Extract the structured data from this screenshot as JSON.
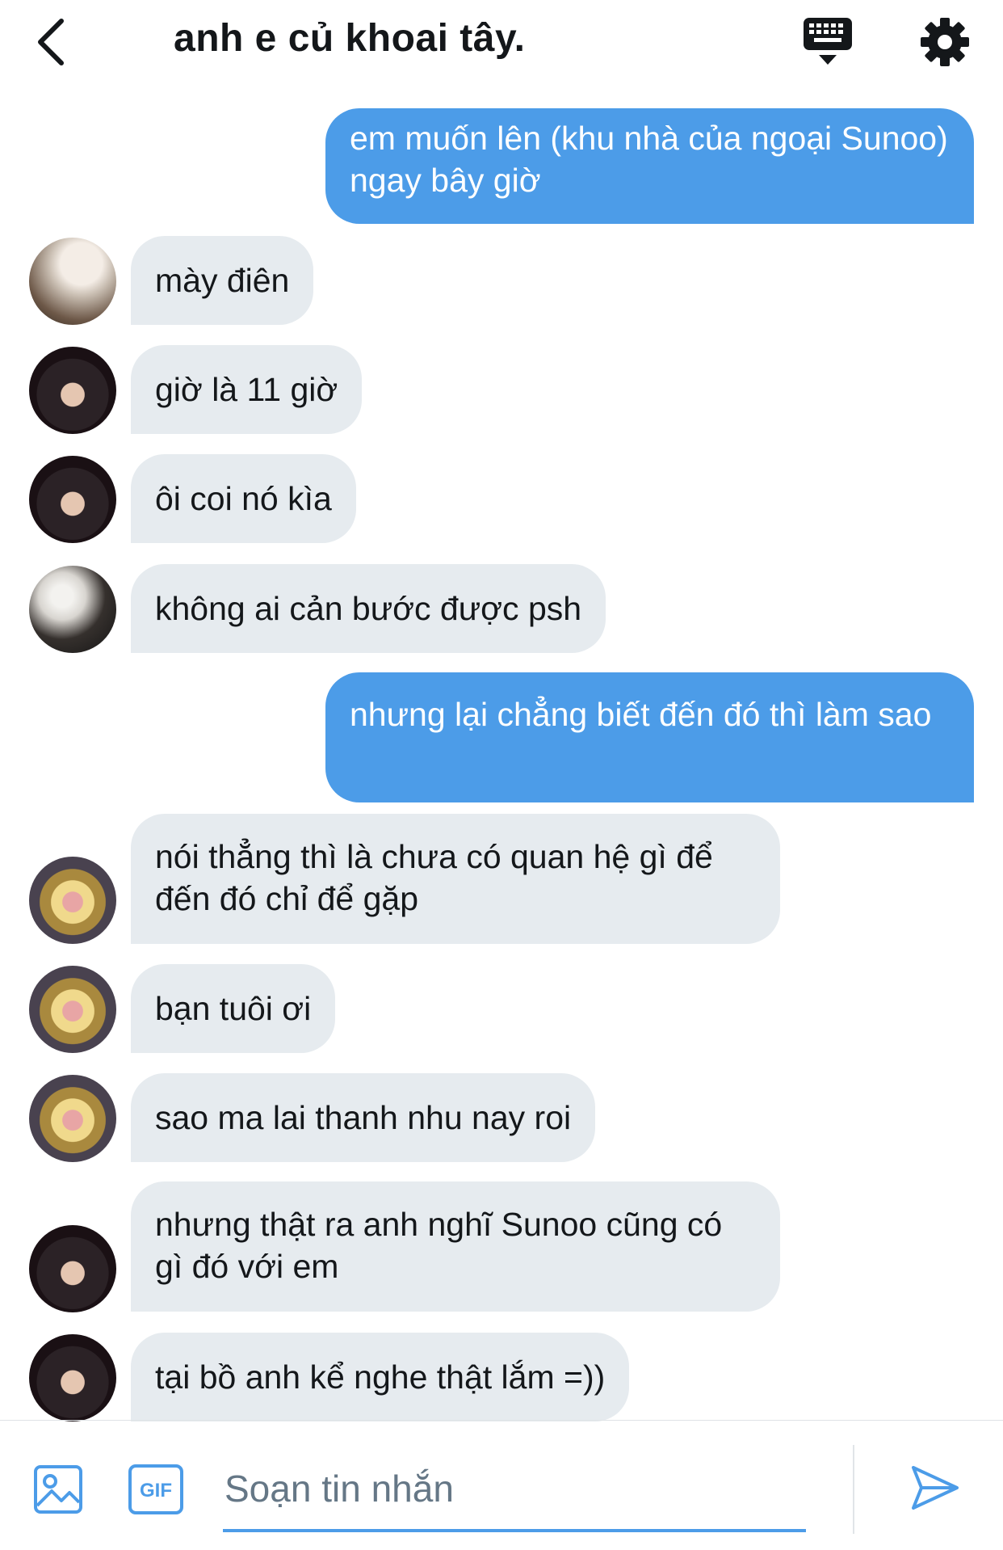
{
  "header": {
    "title": "anh e củ khoai tây."
  },
  "messages": [
    {
      "side": "out",
      "text": "em muốn lên (khu nhà của ngoại Sunoo) ngay bây giờ"
    },
    {
      "side": "in",
      "avatar": "avatar-a",
      "text": "mày điên"
    },
    {
      "side": "in",
      "avatar": "avatar-b",
      "text": "giờ là 11 giờ"
    },
    {
      "side": "in",
      "avatar": "avatar-b",
      "text": "ôi coi nó kìa"
    },
    {
      "side": "in",
      "avatar": "avatar-c",
      "text": "không ai cản bước được psh"
    },
    {
      "side": "out",
      "text": "nhưng lại chẳng biết đến đó thì làm sao"
    },
    {
      "side": "in",
      "avatar": "avatar-d",
      "text": "nói thẳng thì là chưa có quan hệ gì để đến đó chỉ để gặp"
    },
    {
      "side": "in",
      "avatar": "avatar-d",
      "text": "bạn tuôi ơi"
    },
    {
      "side": "in",
      "avatar": "avatar-d",
      "text": "sao ma lai thanh nhu nay roi"
    },
    {
      "side": "in",
      "avatar": "avatar-b",
      "text": "nhưng thật ra anh nghĩ Sunoo cũng có gì đó với em"
    },
    {
      "side": "in",
      "avatar": "avatar-b",
      "text": "tại bồ anh kể nghe thật lắm =))"
    }
  ],
  "composer": {
    "placeholder": "Soạn tin nhắn",
    "gif_label": "GIF"
  },
  "colors": {
    "accent": "#4c9ce8",
    "incoming_bubble": "#e6ebef",
    "text": "#14171a",
    "placeholder": "#657786"
  },
  "icons": {
    "back": "chevron-left-icon",
    "keyboard": "keyboard-icon",
    "settings": "gear-icon",
    "media": "image-icon",
    "gif": "gif-icon",
    "send": "send-icon"
  }
}
